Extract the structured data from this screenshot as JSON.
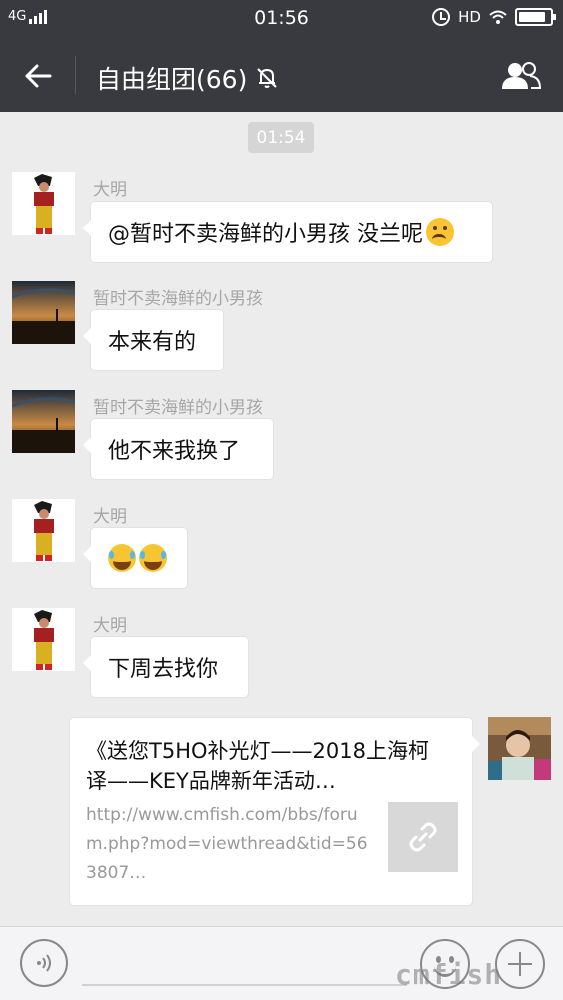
{
  "status_bar": {
    "network": "4G",
    "time": "01:56",
    "hd": "HD",
    "battery_level": 0.85,
    "icons": [
      "signal-icon",
      "alarm-icon",
      "wifi-icon",
      "battery-icon"
    ]
  },
  "header": {
    "title": "自由组团(66)",
    "icons": [
      "back-arrow-icon",
      "mute-bell-icon",
      "group-members-icon"
    ]
  },
  "time_badge": "01:54",
  "messages": [
    {
      "sender": "大明",
      "text": "@暂时不卖海鲜的小男孩 没兰呢",
      "avatar": "anime-character-avatar",
      "emoji": [
        "thinking-face"
      ]
    },
    {
      "sender": "暂时不卖海鲜的小男孩",
      "text": "本来有的",
      "avatar": "sunset-photo-avatar"
    },
    {
      "sender": "暂时不卖海鲜的小男孩",
      "text": "他不来我换了",
      "avatar": "sunset-photo-avatar"
    },
    {
      "sender": "大明",
      "text": "",
      "avatar": "anime-character-avatar",
      "emoji": [
        "laughing-tears-face",
        "laughing-tears-face"
      ]
    },
    {
      "sender": "大明",
      "text": "下周去找你",
      "avatar": "anime-character-avatar"
    }
  ],
  "link_message": {
    "title": "《送您T5HO补光灯——2018上海柯译——KEY品牌新年活动…",
    "url": "http://www.cmfish.com/bbs/forum.php?mod=viewthread&tid=563807…",
    "thumb_icon": "link-icon",
    "avatar": "child-photo-avatar"
  },
  "input_bar": {
    "icons": [
      "voice-icon",
      "emoji-icon",
      "plus-icon"
    ]
  },
  "watermark": "cmfish"
}
